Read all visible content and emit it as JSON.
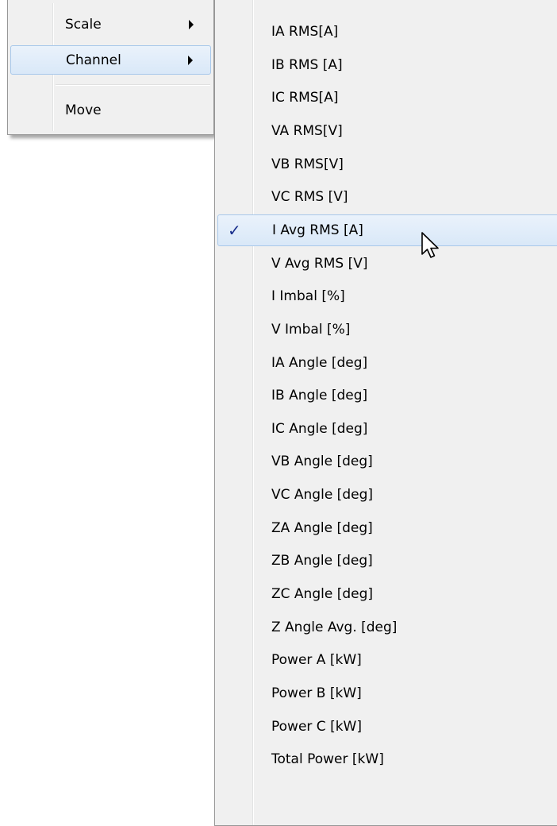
{
  "context_menu": {
    "items": [
      {
        "label": "Scale",
        "has_submenu": true
      },
      {
        "label": "Channel",
        "has_submenu": true,
        "highlighted": true
      },
      {
        "label": "Move",
        "has_submenu": false
      }
    ]
  },
  "channel_submenu": {
    "selected_index": 6,
    "items": [
      {
        "label": "IA RMS[A]"
      },
      {
        "label": "IB RMS [A]"
      },
      {
        "label": "IC RMS[A]"
      },
      {
        "label": "VA RMS[V]"
      },
      {
        "label": "VB RMS[V]"
      },
      {
        "label": "VC RMS [V]"
      },
      {
        "label": "I Avg RMS [A]",
        "checked": true
      },
      {
        "label": "V Avg RMS [V]"
      },
      {
        "label": "I Imbal [%]"
      },
      {
        "label": "V Imbal [%]"
      },
      {
        "label": "IA Angle [deg]"
      },
      {
        "label": "IB Angle [deg]"
      },
      {
        "label": "IC Angle [deg]"
      },
      {
        "label": "VB Angle [deg]"
      },
      {
        "label": "VC Angle [deg]"
      },
      {
        "label": "ZA Angle [deg]"
      },
      {
        "label": "ZB Angle [deg]"
      },
      {
        "label": "ZC Angle [deg]"
      },
      {
        "label": "Z Angle Avg. [deg]"
      },
      {
        "label": "Power A [kW]"
      },
      {
        "label": "Power B [kW]"
      },
      {
        "label": "Power C [kW]"
      },
      {
        "label": "Total Power [kW]"
      }
    ]
  },
  "colors": {
    "menu_background": "#f0f0f0",
    "highlight_border": "#a8c8ea",
    "checkmark": "#1a2f8c"
  },
  "icons": {
    "submenu_arrow": "chevron-right-icon",
    "check": "checkmark-icon",
    "cursor": "mouse-pointer-icon"
  }
}
